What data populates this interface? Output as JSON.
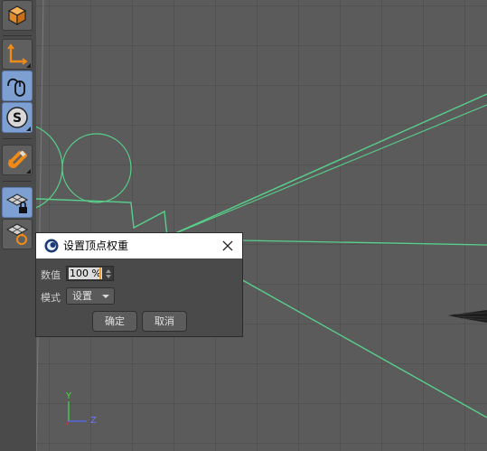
{
  "toolbar": {
    "tools": [
      {
        "name": "cube-icon",
        "active": false
      },
      {
        "name": "axis-tool-icon",
        "active": false
      },
      {
        "name": "mouse-icon",
        "active": true
      },
      {
        "name": "snap-icon",
        "active": true
      },
      {
        "name": "magnet-icon",
        "active": false
      },
      {
        "name": "grid-lock-icon",
        "active": true
      },
      {
        "name": "grid-cycle-icon",
        "active": false
      }
    ]
  },
  "dialog": {
    "title": "设置顶点权重",
    "value_label": "数值",
    "value": "100 %",
    "mode_label": "模式",
    "mode_value": "设置",
    "ok_label": "确定",
    "cancel_label": "取消"
  },
  "axis_gizmo": {
    "y_label": "Y",
    "z_label": "Z"
  },
  "colors": {
    "spline": "#58d08a",
    "active_tool": "#7e9fd1",
    "axis_y": "#44dd44",
    "axis_x": "#dd3333",
    "axis_z": "#5566ff"
  }
}
